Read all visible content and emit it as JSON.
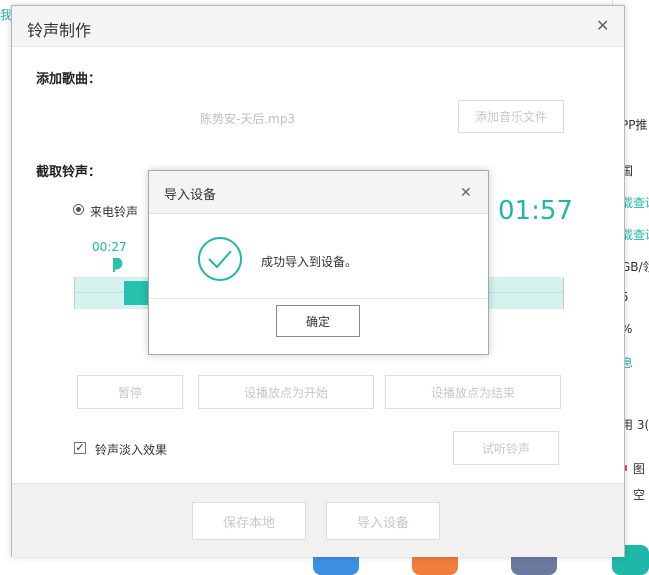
{
  "background": {
    "left_text": "我",
    "right_items": [
      {
        "text": "PP推",
        "color": "default"
      },
      {
        "text": "国",
        "color": "default"
      },
      {
        "text": "载查询",
        "color": "teal"
      },
      {
        "text": "载查询",
        "color": "teal"
      },
      {
        "text": "GB/领",
        "color": "default"
      },
      {
        "text": "5",
        "color": "default"
      },
      {
        "text": "%",
        "color": "default"
      },
      {
        "text": "息",
        "color": "teal"
      },
      {
        "text": "用 3(",
        "color": "default"
      },
      {
        "text": "图",
        "color": "default"
      },
      {
        "text": "空",
        "color": "default"
      }
    ],
    "colors": {
      "teal": "#1fb8a8",
      "red": "#e54b4b"
    }
  },
  "dialog": {
    "title": "铃声制作",
    "add_song_label": "添加歌曲：",
    "song_filename": "陈势安-天后.mp3",
    "add_music_button": "添加音乐文件",
    "clip_label": "截取铃声：",
    "radio_label": "来电铃声",
    "total_time": "01:57",
    "marker_time": "00:27",
    "pause_button": "暂停",
    "set_start_button": "设播放点为开始",
    "set_end_button": "设播放点为结束",
    "fade_checkbox_label": "铃声淡入效果",
    "fade_checked": true,
    "preview_button": "试听铃声",
    "save_local_button": "保存本地",
    "import_device_button": "导入设备",
    "accent_color": "#1fb8a8"
  },
  "popup": {
    "title": "导入设备",
    "message": "成功导入到设备。",
    "ok_button": "确定",
    "icon": "check-circle-icon"
  }
}
